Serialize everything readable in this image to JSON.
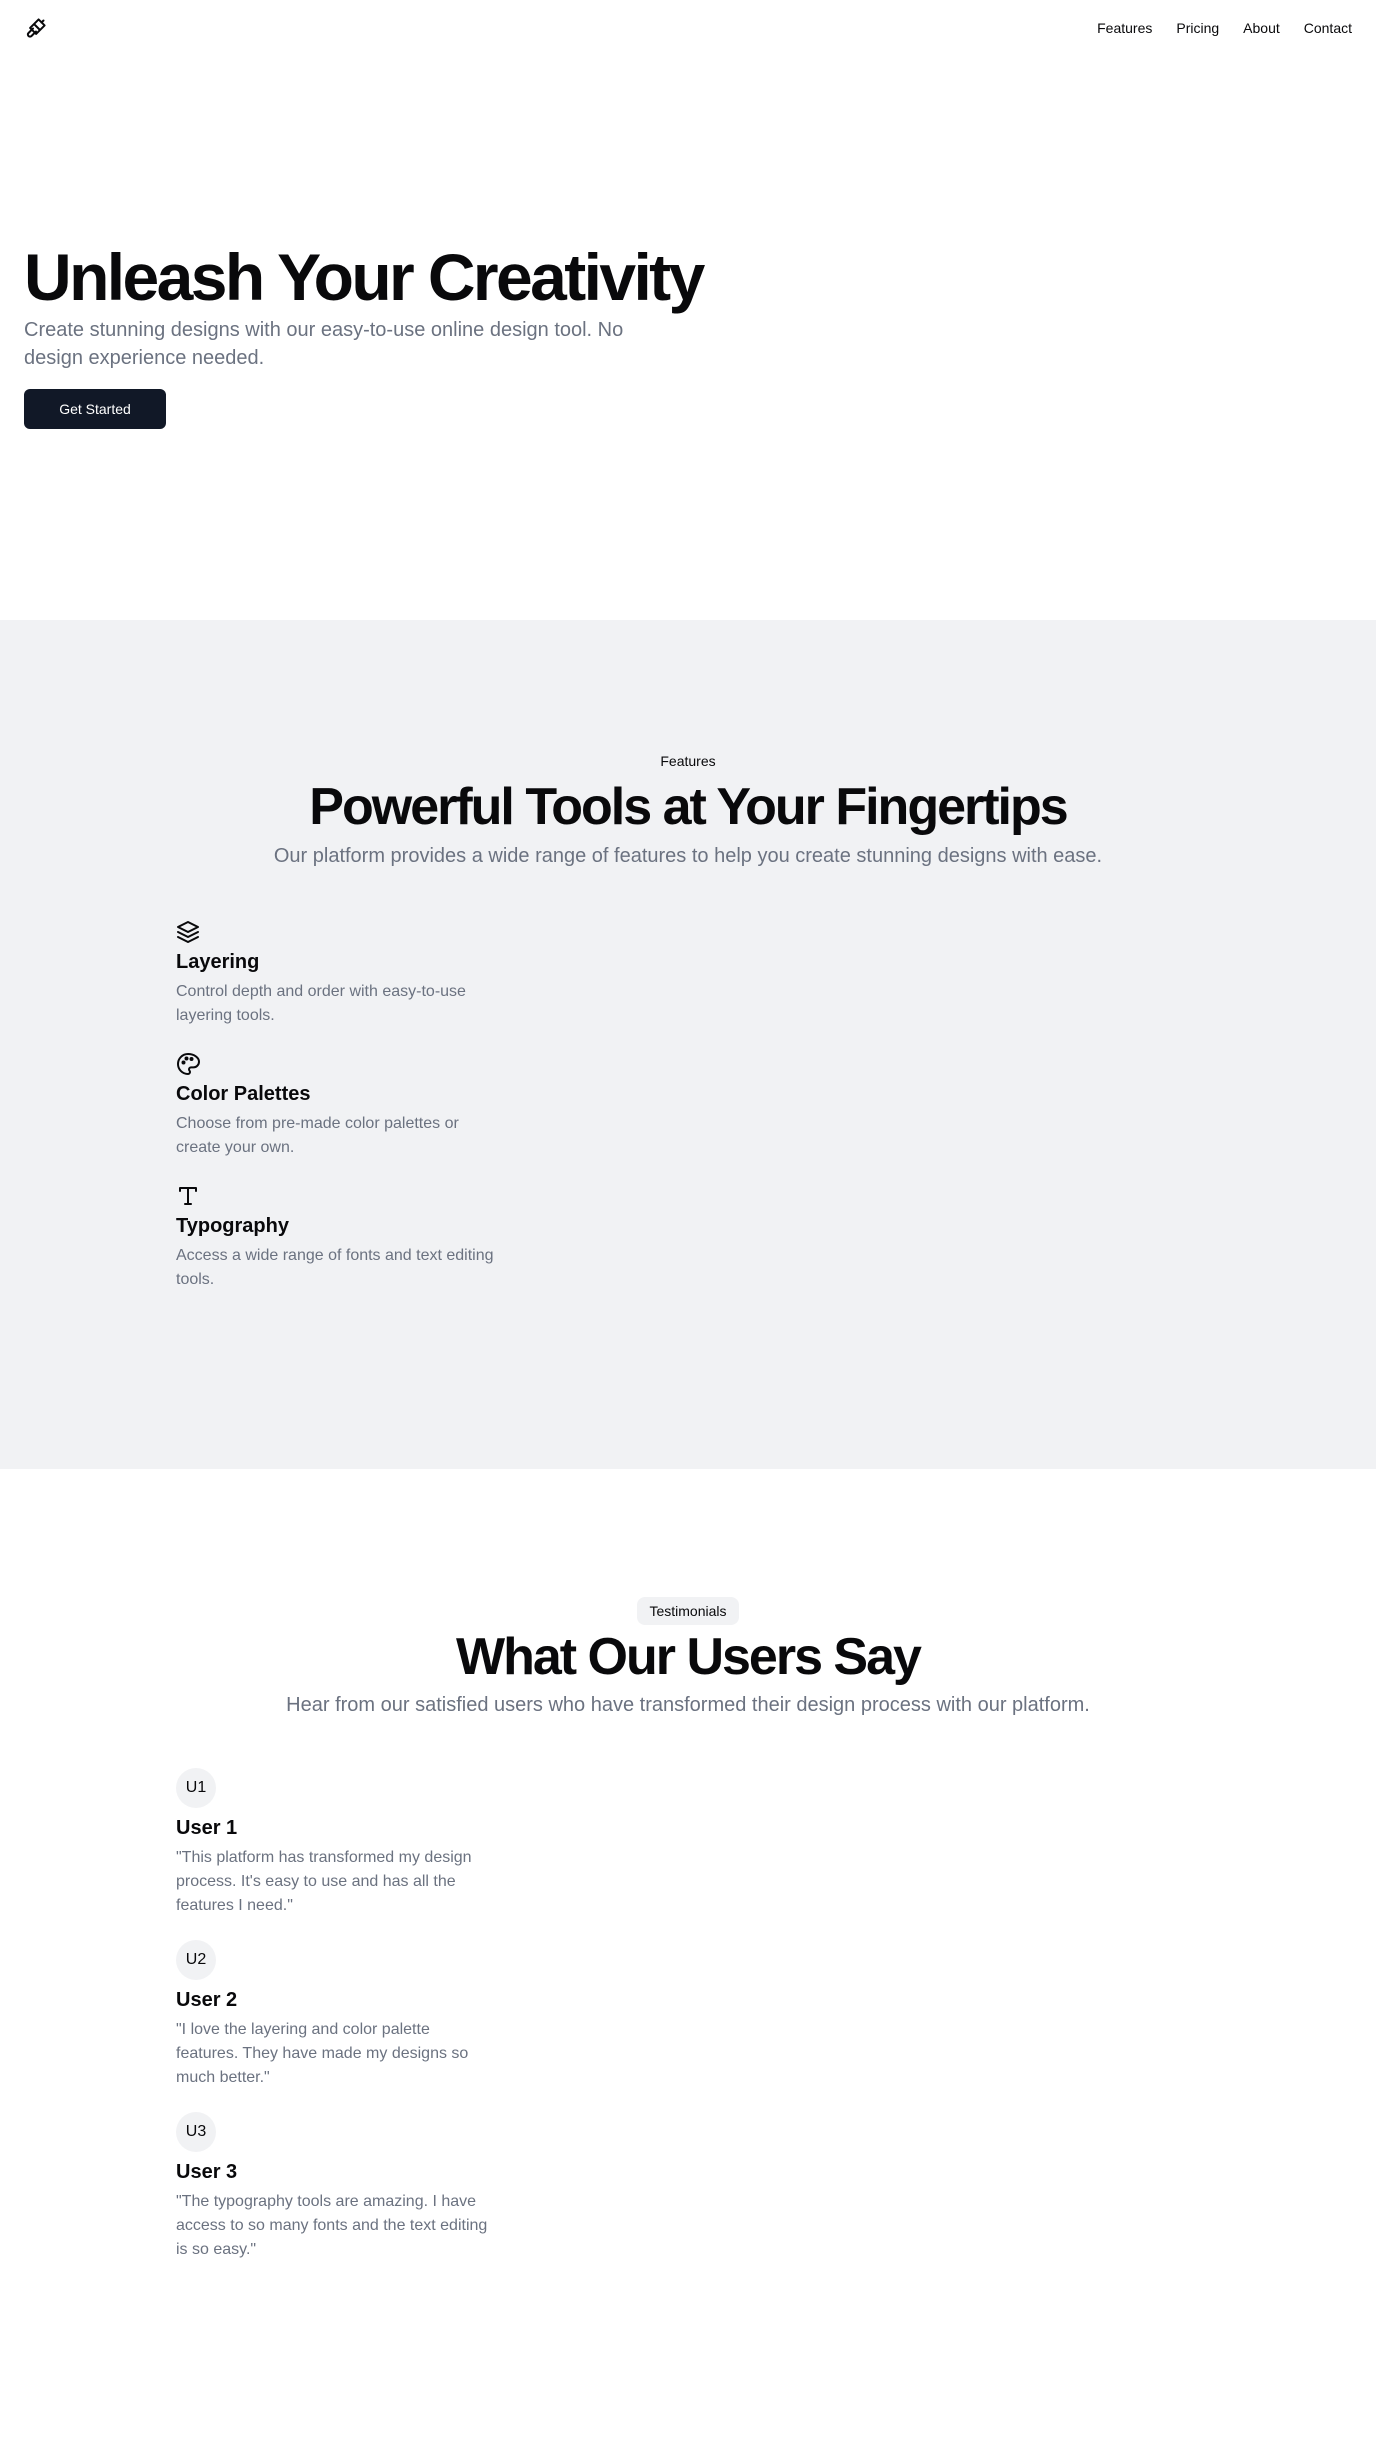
{
  "header": {
    "logo_icon": "paintbrush-icon",
    "nav": [
      {
        "label": "Features"
      },
      {
        "label": "Pricing"
      },
      {
        "label": "About"
      },
      {
        "label": "Contact"
      }
    ]
  },
  "hero": {
    "title": "Unleash Your Creativity",
    "subtitle": "Create stunning designs with our easy-to-use online design tool. No design experience needed.",
    "cta_label": "Get Started"
  },
  "features": {
    "eyebrow": "Features",
    "title": "Powerful Tools at Your Fingertips",
    "subtitle": "Our platform provides a wide range of features to help you create stunning designs with ease.",
    "items": [
      {
        "icon": "layers-icon",
        "title": "Layering",
        "description": "Control depth and order with easy-to-use layering tools."
      },
      {
        "icon": "palette-icon",
        "title": "Color Palettes",
        "description": "Choose from pre-made color palettes or create your own."
      },
      {
        "icon": "type-icon",
        "title": "Typography",
        "description": "Access a wide range of fonts and text editing tools."
      }
    ]
  },
  "testimonials": {
    "badge": "Testimonials",
    "title": "What Our Users Say",
    "subtitle": "Hear from our satisfied users who have transformed their design process with our platform.",
    "items": [
      {
        "avatar": "U1",
        "name": "User 1",
        "quote": "\"This platform has transformed my design process. It's easy to use and has all the features I need.\""
      },
      {
        "avatar": "U2",
        "name": "User 2",
        "quote": "\"I love the layering and color palette features. They have made my designs so much better.\""
      },
      {
        "avatar": "U3",
        "name": "User 3",
        "quote": "\"The typography tools are amazing. I have access to so many fonts and the text editing is so easy.\""
      }
    ]
  },
  "colors": {
    "primary": "#111827",
    "muted_text": "#6b7280",
    "section_bg": "#f1f2f4"
  }
}
